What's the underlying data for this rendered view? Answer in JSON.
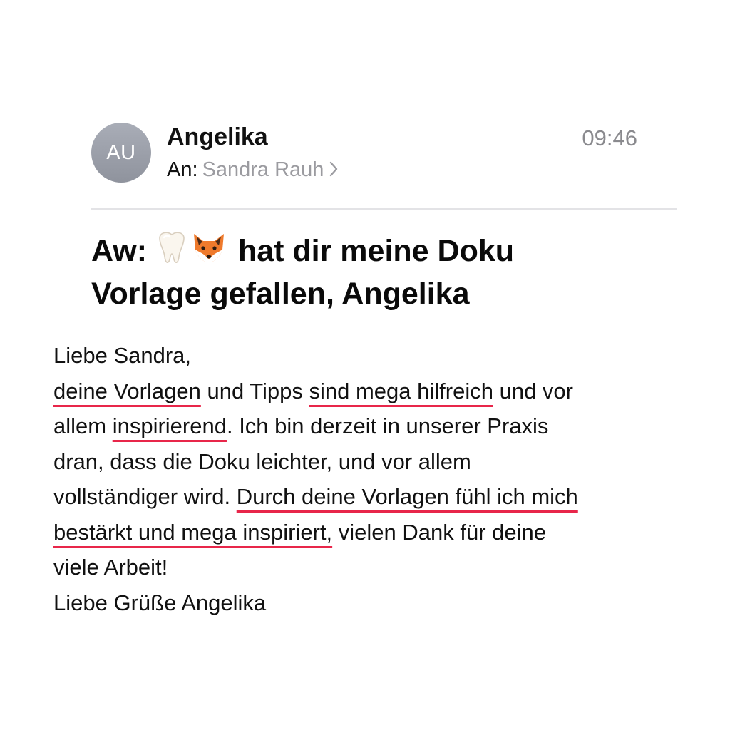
{
  "email": {
    "avatar_initials": "AU",
    "sender": "Angelika",
    "time": "09:46",
    "to_label": "An:",
    "to_name": "Sandra Rauh",
    "subject_prefix": "Aw:",
    "subject_emojis": [
      "tooth",
      "fox"
    ],
    "subject_line1_rest": "hat dir meine Doku",
    "subject_line2": "Vorlage gefallen, Angelika"
  },
  "body": {
    "greeting": "Liebe Sandra,",
    "line2": {
      "hl1": "deine Vorlagen",
      "t1": " und Tipps ",
      "hl2": "sind mega hilfreich",
      "t2": " und vor"
    },
    "line3": {
      "t1": "allem ",
      "hl1": "inspirierend",
      "t2": ". Ich bin derzeit in unserer Praxis"
    },
    "line4": "dran, dass die Doku leichter, und vor allem",
    "line5": {
      "t1": "vollständiger wird. ",
      "hl1": "Durch deine Vorlagen fühl ich mich"
    },
    "line6": {
      "hl1": "bestärkt und mega inspiriert,",
      "t1": " vielen Dank für deine"
    },
    "line7": "viele Arbeit!",
    "signoff": "Liebe Grüße Angelika"
  },
  "colors": {
    "underline_accent": "#e8264a",
    "avatar": "#9a9ea8",
    "secondary_text": "#8a8a8e"
  }
}
